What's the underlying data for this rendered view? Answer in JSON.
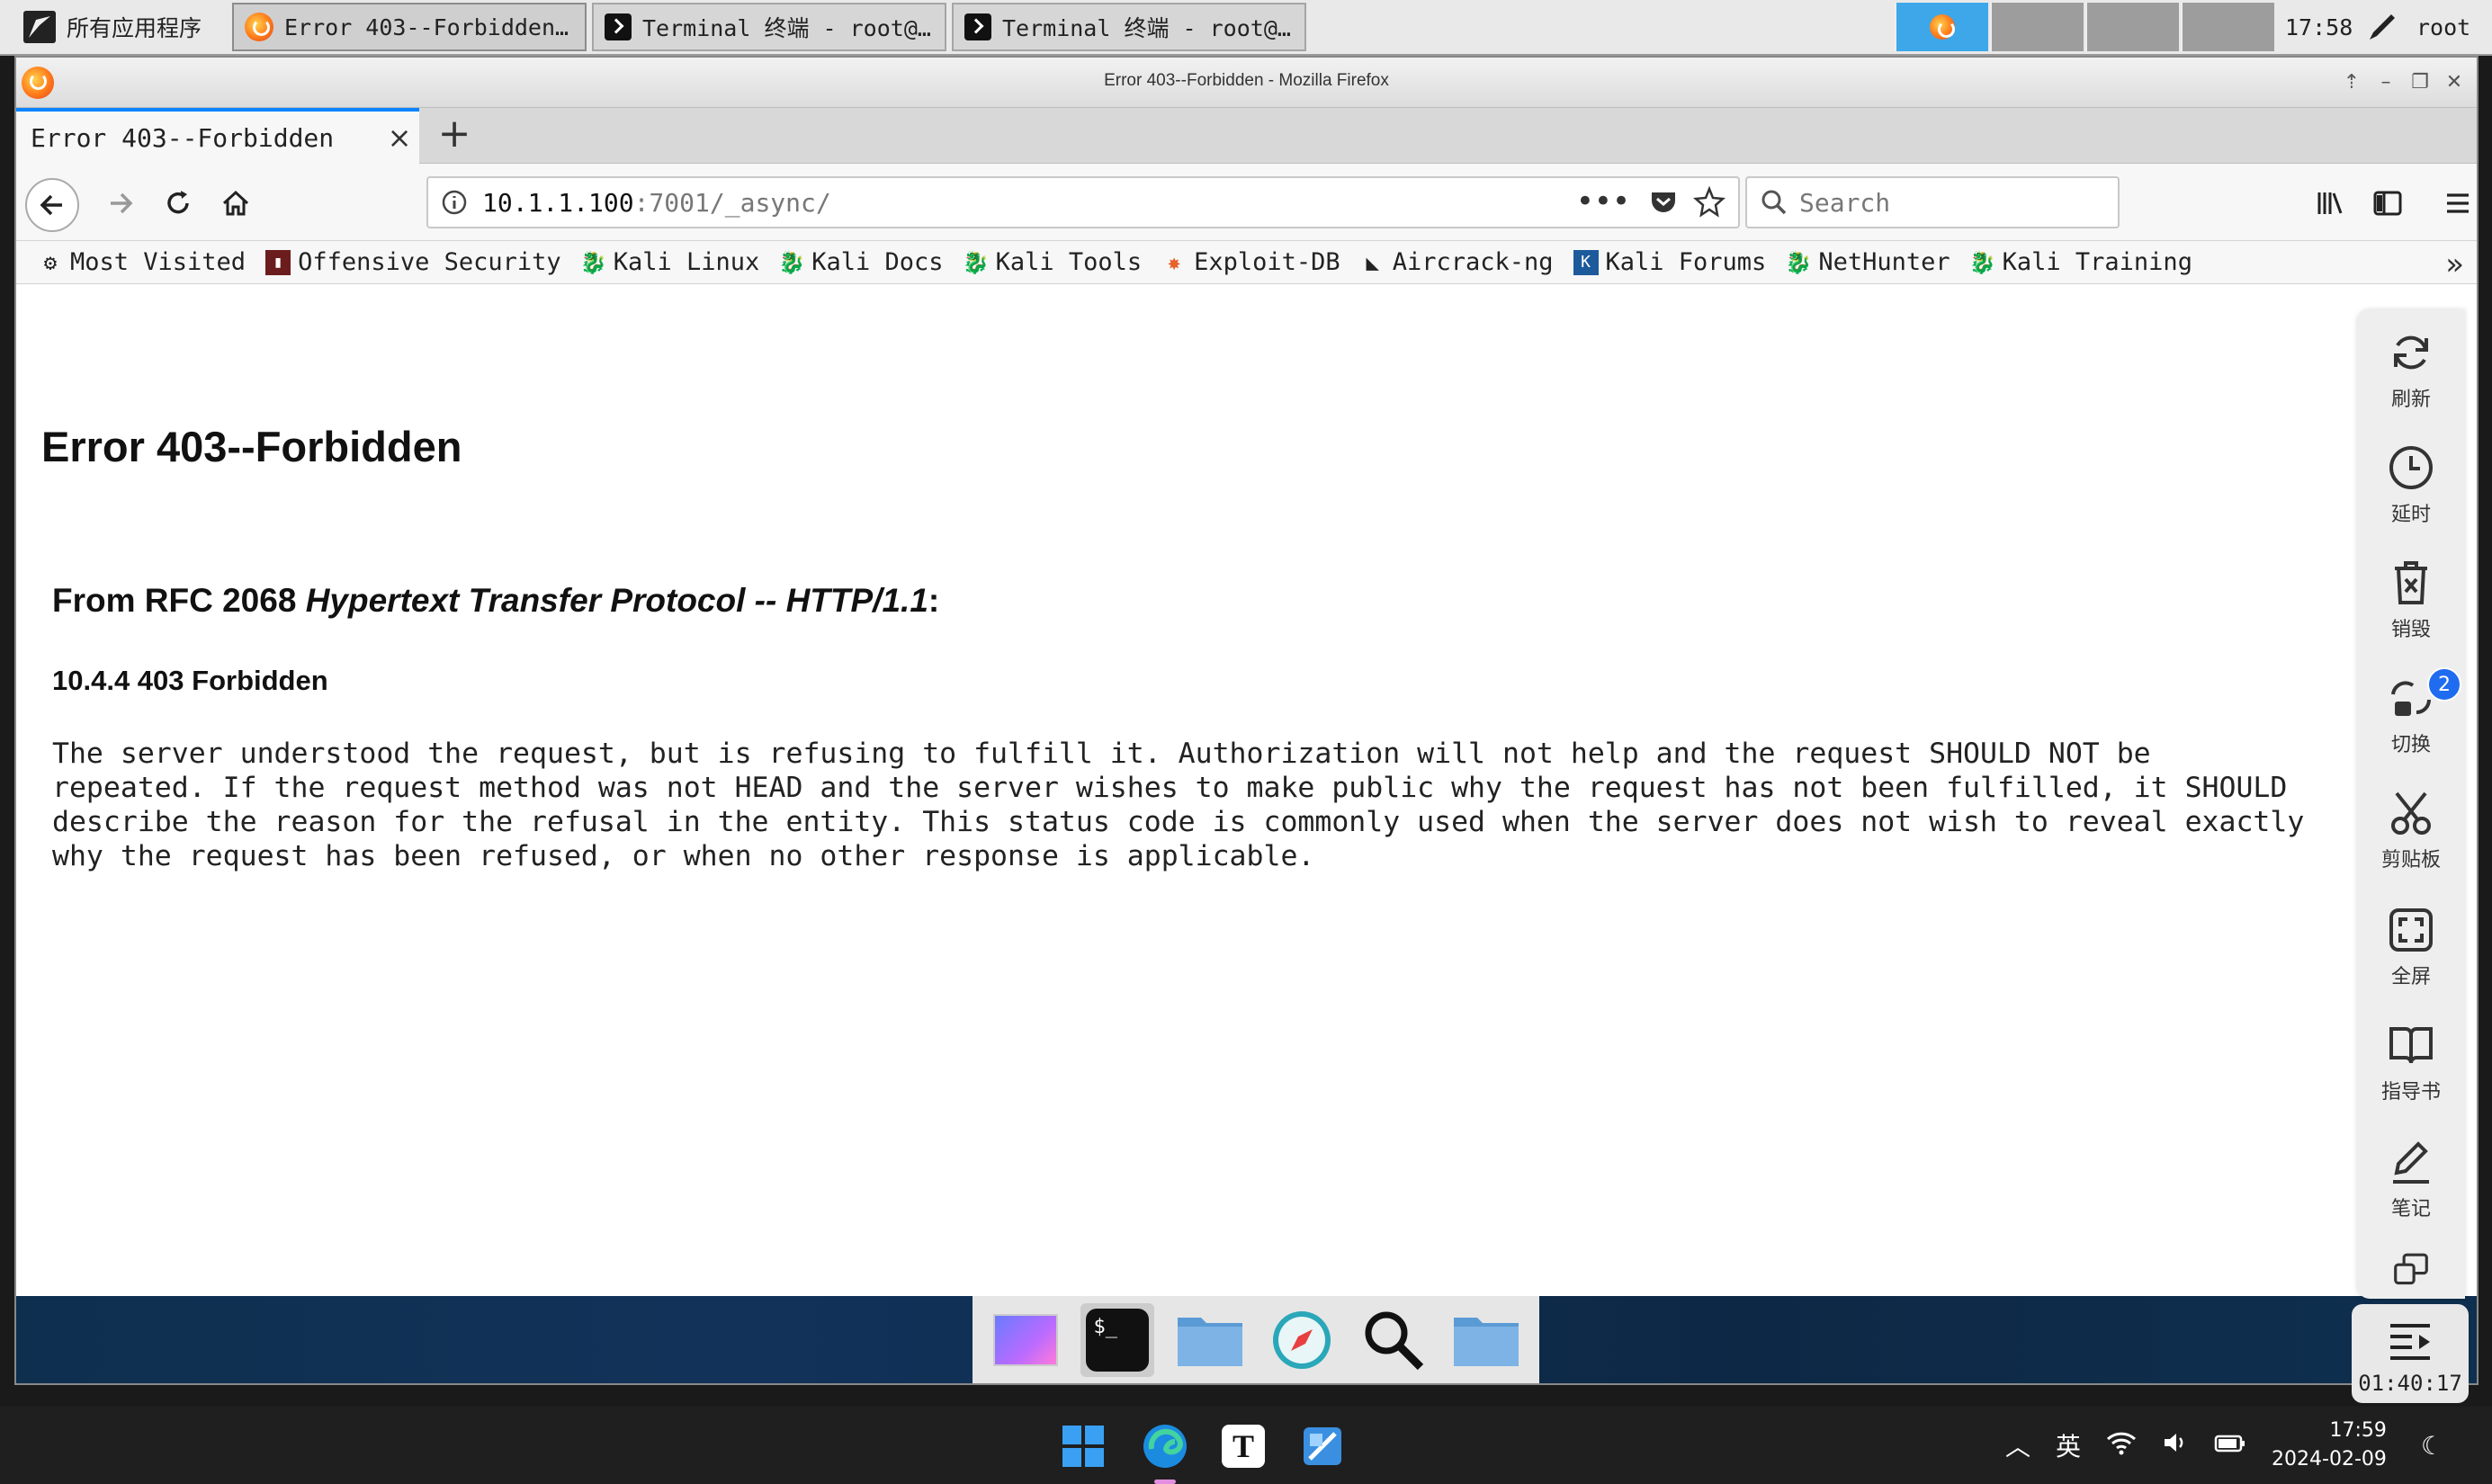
{
  "panel": {
    "apps_menu": "所有应用程序",
    "tasks": [
      {
        "label": "Error 403--Forbidden - …"
      },
      {
        "label": "Terminal 终端 - root@ka…"
      },
      {
        "label": "Terminal 终端 - root@ka…"
      }
    ],
    "time": "17:58",
    "user": "root"
  },
  "window": {
    "title": "Error 403--Forbidden - Mozilla Firefox"
  },
  "tab": {
    "title": "Error 403--Forbidden"
  },
  "urlbar": {
    "host": "10.1.1.100",
    "path": ":7001/_async/"
  },
  "search": {
    "placeholder": "Search"
  },
  "bookmarks": [
    {
      "label": "Most Visited"
    },
    {
      "label": "Offensive Security"
    },
    {
      "label": "Kali Linux"
    },
    {
      "label": "Kali Docs"
    },
    {
      "label": "Kali Tools"
    },
    {
      "label": "Exploit-DB"
    },
    {
      "label": "Aircrack-ng"
    },
    {
      "label": "Kali Forums"
    },
    {
      "label": "NetHunter"
    },
    {
      "label": "Kali Training"
    }
  ],
  "page": {
    "heading": "Error 403--Forbidden",
    "rfc_prefix": "From RFC 2068 ",
    "rfc_title": "Hypertext Transfer Protocol -- HTTP/1.1",
    "rfc_suffix": ":",
    "section": "10.4.4 403 Forbidden",
    "body": "The server understood the request, but is refusing to fulfill it. Authorization will not help and the request SHOULD NOT be\nrepeated. If the request method was not HEAD and the server wishes to make public why the request has not been fulfilled, it SHOULD\ndescribe the reason for the refusal in the entity. This status code is commonly used when the server does not wish to reveal exactly\nwhy the request has been refused, or when no other response is applicable."
  },
  "tools": {
    "refresh": "刷新",
    "delay": "延时",
    "destroy": "销毁",
    "switch": "切换",
    "switch_badge": "2",
    "clipboard": "剪贴板",
    "fullscreen": "全屏",
    "guide": "指导书",
    "notes": "笔记",
    "timer": "01:40:17"
  },
  "taskbar": {
    "ime": "英",
    "time": "17:59",
    "date": "2024-02-09"
  }
}
